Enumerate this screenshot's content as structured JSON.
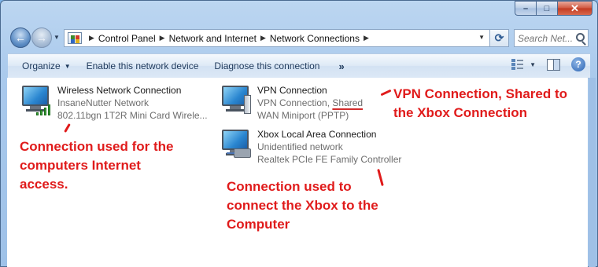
{
  "window": {
    "controls": {
      "minimize": "–",
      "maximize": "□",
      "close": "✕"
    }
  },
  "navigation": {
    "back_icon": "back-arrow-icon",
    "forward_icon": "forward-arrow-icon",
    "breadcrumb": [
      "Control Panel",
      "Network and Internet",
      "Network Connections"
    ],
    "search_placeholder": "Search Net..."
  },
  "toolbar": {
    "organize": "Organize",
    "enable_device": "Enable this network device",
    "diagnose": "Diagnose this connection",
    "more": "»"
  },
  "connections": [
    {
      "name": "Wireless Network Connection",
      "line2": "InsaneNutter Network",
      "line3": "802.11bgn 1T2R Mini Card Wirele...",
      "icon": "wireless-network-icon"
    },
    {
      "name": "VPN Connection",
      "line2_prefix": "VPN Connection, ",
      "line2_shared": "Shared",
      "line3": "WAN Miniport (PPTP)",
      "icon": "vpn-connection-icon"
    },
    {
      "name": "Xbox Local Area Connection",
      "line2": "Unidentified network",
      "line3": "Realtek PCIe FE Family Controller",
      "icon": "wired-network-icon"
    }
  ],
  "annotations": {
    "internet": [
      "Connection used for the",
      "computers Internet",
      "access."
    ],
    "vpn": [
      "VPN Connection, Shared to",
      "the Xbox Connection"
    ],
    "xbox": [
      "Connection used to",
      "connect the Xbox to the",
      "Computer"
    ],
    "color": "#e01b1b"
  }
}
